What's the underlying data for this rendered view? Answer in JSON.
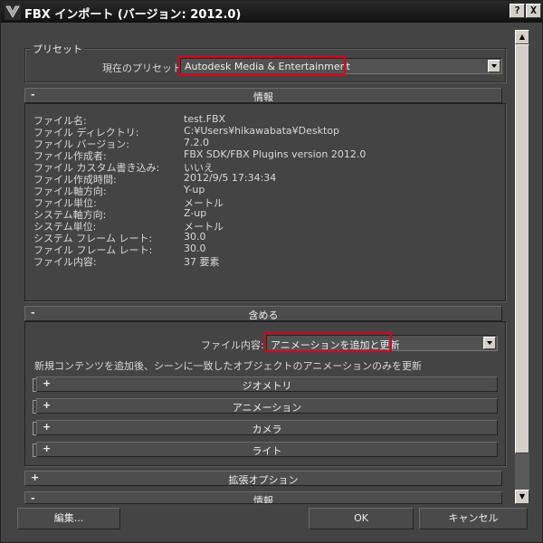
{
  "window": {
    "title": "FBX インポート (バージョン: 2012.0)",
    "help": "?",
    "close": "X"
  },
  "preset": {
    "group_label": "プリセット",
    "current_label": "現在のプリセット:",
    "current_value": "Autodesk Media & Entertainment"
  },
  "info": {
    "header": "情報",
    "sign": "-",
    "rows": [
      {
        "key": "ファイル名:",
        "value": "test.FBX"
      },
      {
        "key": "ファイル ディレクトリ:",
        "value": "C:¥Users¥hikawabata¥Desktop"
      },
      {
        "key": "ファイル バージョン:",
        "value": "7.2.0"
      },
      {
        "key": "ファイル作成者:",
        "value": "FBX SDK/FBX Plugins version 2012.0"
      },
      {
        "key": "ファイル カスタム書き込み:",
        "value": "いいえ"
      },
      {
        "key": "ファイル作成時間:",
        "value": "2012/9/5  17:34:34"
      },
      {
        "key": "ファイル軸方向:",
        "value": "Y-up"
      },
      {
        "key": "ファイル単位:",
        "value": "メートル"
      },
      {
        "key": "システム軸方向:",
        "value": "Z-up"
      },
      {
        "key": "システム単位:",
        "value": "メートル"
      },
      {
        "key": "システム フレーム レート:",
        "value": "30.0"
      },
      {
        "key": "ファイル フレーム レート:",
        "value": "30.0"
      },
      {
        "key": "ファイル内容:",
        "value": "37 要素"
      }
    ]
  },
  "include": {
    "header": "含める",
    "sign": "-",
    "content_label": "ファイル内容:",
    "content_value": "アニメーションを追加と更新",
    "description": "新規コンテンツを追加後、シーンに一致したオブジェクトのアニメーションのみを更新",
    "subsections": [
      {
        "sign": "+",
        "label": "ジオメトリ"
      },
      {
        "sign": "+",
        "label": "アニメーション"
      },
      {
        "sign": "+",
        "label": "カメラ"
      },
      {
        "sign": "+",
        "label": "ライト"
      }
    ]
  },
  "advanced": {
    "sign": "+",
    "header": "拡張オプション"
  },
  "info2": {
    "sign": "-",
    "header": "情報"
  },
  "buttons": {
    "edit": "編集...",
    "ok": "OK",
    "cancel": "キャンセル"
  },
  "colors": {
    "highlight": "#e2001a",
    "background": "#444444"
  }
}
